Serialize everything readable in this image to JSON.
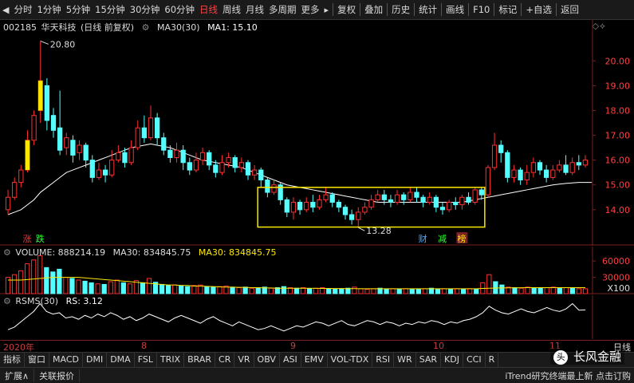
{
  "toolbar": {
    "periods": [
      "分时",
      "1分钟",
      "5分钟",
      "15分钟",
      "30分钟",
      "60分钟",
      "日线",
      "周线",
      "月线",
      "多周期",
      "更多"
    ],
    "active_period": "日线",
    "more_arrow": "▸",
    "tools": [
      "复权",
      "叠加",
      "历史",
      "统计",
      "画线",
      "F10",
      "标记",
      "+自选",
      "返回"
    ]
  },
  "main": {
    "title": {
      "code": "002185",
      "name": "华天科技",
      "mode": "(日线 前复权)",
      "ma_label": "MA30(30)",
      "ma_value": "MA1: 15.10"
    },
    "annotations": {
      "high_label": "20.80",
      "low_label": "13.28",
      "tag_zhang": "涨",
      "tag_die": "跌",
      "tag_cai": "财",
      "tag_jian": "减",
      "tag_bang": "榜"
    },
    "colors": {
      "up": "#ff3030",
      "down": "#55ffff",
      "ma": "#ffffff",
      "box": "#ffe800",
      "axis": "#7a2020",
      "label": "#ff4040"
    }
  },
  "volume": {
    "title": "VOLUME: 888214.19",
    "ma30": "MA30: 834845.75",
    "ma30b": "MA30: 834845.75",
    "scale": "X100",
    "ticks": [
      "60000",
      "30000"
    ]
  },
  "rsms": {
    "title": "RSMS(30)",
    "value": "RS: 3.12"
  },
  "date_axis": {
    "labels": [
      "2020年",
      "8",
      "9",
      "10",
      "11"
    ],
    "day": "日线"
  },
  "indicators": [
    "指标",
    "窗口",
    "MACD",
    "DMI",
    "DMA",
    "FSL",
    "TRIX",
    "BRAR",
    "CR",
    "VR",
    "OBV",
    "ASI",
    "EMV",
    "VOL-TDX",
    "RSI",
    "WR",
    "SAR",
    "KDJ",
    "CCI",
    "R"
  ],
  "status": {
    "expand": "扩展∧",
    "report": "关联报价",
    "brand": "长风金融",
    "right": "iTrend研究终端最上新 点击订购"
  },
  "chart_data": [
    {
      "type": "candlestick",
      "title": "002185 华天科技 (日线 前复权)",
      "y_ticks": [
        14.0,
        15.0,
        16.0,
        17.0,
        18.0,
        19.0,
        20.0
      ],
      "ylim": [
        12.9,
        21.2
      ],
      "x_labels": [
        "2020年",
        "8",
        "9",
        "10",
        "11"
      ],
      "high_annotation": 20.8,
      "low_annotation": 13.28,
      "ma30_last": 15.1,
      "candles": [
        {
          "o": 14.0,
          "c": 14.5,
          "h": 14.8,
          "l": 13.8
        },
        {
          "o": 14.5,
          "c": 15.1,
          "h": 15.3,
          "l": 14.4
        },
        {
          "o": 15.1,
          "c": 15.6,
          "h": 15.8,
          "l": 14.9
        },
        {
          "o": 15.6,
          "c": 16.8,
          "h": 17.2,
          "l": 15.5
        },
        {
          "o": 16.8,
          "c": 17.8,
          "h": 18.0,
          "l": 16.6
        },
        {
          "o": 18.0,
          "c": 19.2,
          "h": 20.8,
          "l": 17.5
        },
        {
          "o": 19.0,
          "c": 17.6,
          "h": 19.3,
          "l": 17.2
        },
        {
          "o": 17.8,
          "c": 17.2,
          "h": 18.1,
          "l": 16.9
        },
        {
          "o": 17.3,
          "c": 16.4,
          "h": 18.8,
          "l": 16.2
        },
        {
          "o": 16.5,
          "c": 16.9,
          "h": 17.1,
          "l": 16.2
        },
        {
          "o": 16.8,
          "c": 16.2,
          "h": 17.0,
          "l": 15.9
        },
        {
          "o": 16.3,
          "c": 16.6,
          "h": 16.8,
          "l": 16.0
        },
        {
          "o": 16.6,
          "c": 16.0,
          "h": 16.7,
          "l": 15.7
        },
        {
          "o": 16.0,
          "c": 15.3,
          "h": 16.2,
          "l": 15.1
        },
        {
          "o": 15.3,
          "c": 15.6,
          "h": 15.9,
          "l": 15.2
        },
        {
          "o": 15.6,
          "c": 15.4,
          "h": 15.8,
          "l": 15.1
        },
        {
          "o": 15.4,
          "c": 16.0,
          "h": 16.4,
          "l": 15.3
        },
        {
          "o": 16.0,
          "c": 16.3,
          "h": 16.6,
          "l": 15.9
        },
        {
          "o": 16.3,
          "c": 15.9,
          "h": 16.5,
          "l": 15.7
        },
        {
          "o": 15.9,
          "c": 16.5,
          "h": 16.8,
          "l": 15.8
        },
        {
          "o": 16.5,
          "c": 17.3,
          "h": 17.6,
          "l": 16.4
        },
        {
          "o": 17.3,
          "c": 16.9,
          "h": 17.8,
          "l": 16.7
        },
        {
          "o": 16.9,
          "c": 17.7,
          "h": 18.2,
          "l": 16.8
        },
        {
          "o": 17.7,
          "c": 16.9,
          "h": 17.9,
          "l": 16.6
        },
        {
          "o": 16.9,
          "c": 16.4,
          "h": 17.1,
          "l": 16.2
        },
        {
          "o": 16.4,
          "c": 16.1,
          "h": 16.6,
          "l": 15.9
        },
        {
          "o": 16.1,
          "c": 16.4,
          "h": 16.7,
          "l": 15.9
        },
        {
          "o": 16.4,
          "c": 15.9,
          "h": 16.6,
          "l": 15.6
        },
        {
          "o": 15.9,
          "c": 15.6,
          "h": 16.1,
          "l": 15.4
        },
        {
          "o": 15.6,
          "c": 16.0,
          "h": 16.3,
          "l": 15.5
        },
        {
          "o": 16.0,
          "c": 16.3,
          "h": 16.5,
          "l": 15.8
        },
        {
          "o": 16.3,
          "c": 15.8,
          "h": 16.4,
          "l": 15.6
        },
        {
          "o": 15.8,
          "c": 15.5,
          "h": 16.0,
          "l": 15.3
        },
        {
          "o": 15.5,
          "c": 15.9,
          "h": 16.2,
          "l": 15.4
        },
        {
          "o": 15.9,
          "c": 16.1,
          "h": 16.3,
          "l": 15.7
        },
        {
          "o": 16.1,
          "c": 15.7,
          "h": 16.2,
          "l": 15.5
        },
        {
          "o": 15.7,
          "c": 15.9,
          "h": 16.1,
          "l": 15.5
        },
        {
          "o": 15.9,
          "c": 15.4,
          "h": 16.0,
          "l": 15.2
        },
        {
          "o": 15.4,
          "c": 15.6,
          "h": 15.8,
          "l": 15.2
        },
        {
          "o": 15.6,
          "c": 15.2,
          "h": 15.7,
          "l": 14.9
        },
        {
          "o": 15.2,
          "c": 14.7,
          "h": 15.3,
          "l": 14.5
        },
        {
          "o": 14.7,
          "c": 15.0,
          "h": 15.2,
          "l": 14.6
        },
        {
          "o": 15.0,
          "c": 14.4,
          "h": 15.1,
          "l": 14.2
        },
        {
          "o": 14.4,
          "c": 13.9,
          "h": 14.5,
          "l": 13.7
        },
        {
          "o": 13.9,
          "c": 14.3,
          "h": 14.5,
          "l": 13.6
        },
        {
          "o": 14.3,
          "c": 14.0,
          "h": 14.4,
          "l": 13.8
        },
        {
          "o": 14.0,
          "c": 14.3,
          "h": 14.5,
          "l": 13.9
        },
        {
          "o": 14.3,
          "c": 14.1,
          "h": 14.6,
          "l": 13.9
        },
        {
          "o": 14.1,
          "c": 14.4,
          "h": 14.6,
          "l": 14.0
        },
        {
          "o": 14.4,
          "c": 14.6,
          "h": 14.9,
          "l": 14.3
        },
        {
          "o": 14.6,
          "c": 14.3,
          "h": 14.7,
          "l": 14.1
        },
        {
          "o": 14.3,
          "c": 14.1,
          "h": 14.4,
          "l": 13.9
        },
        {
          "o": 14.1,
          "c": 13.8,
          "h": 14.2,
          "l": 13.6
        },
        {
          "o": 13.8,
          "c": 13.6,
          "h": 14.0,
          "l": 13.4
        },
        {
          "o": 13.6,
          "c": 13.9,
          "h": 14.1,
          "l": 13.28
        },
        {
          "o": 13.9,
          "c": 14.1,
          "h": 14.3,
          "l": 13.8
        },
        {
          "o": 14.1,
          "c": 14.4,
          "h": 14.6,
          "l": 14.0
        },
        {
          "o": 14.4,
          "c": 14.6,
          "h": 14.8,
          "l": 14.3
        },
        {
          "o": 14.6,
          "c": 14.4,
          "h": 14.8,
          "l": 14.2
        },
        {
          "o": 14.4,
          "c": 14.3,
          "h": 14.6,
          "l": 14.1
        },
        {
          "o": 14.3,
          "c": 14.6,
          "h": 14.8,
          "l": 14.2
        },
        {
          "o": 14.6,
          "c": 14.4,
          "h": 14.7,
          "l": 14.2
        },
        {
          "o": 14.4,
          "c": 14.7,
          "h": 14.9,
          "l": 14.3
        },
        {
          "o": 14.7,
          "c": 14.5,
          "h": 14.9,
          "l": 14.3
        },
        {
          "o": 14.5,
          "c": 14.3,
          "h": 14.6,
          "l": 14.1
        },
        {
          "o": 14.3,
          "c": 14.5,
          "h": 14.7,
          "l": 14.2
        },
        {
          "o": 14.5,
          "c": 14.1,
          "h": 14.6,
          "l": 13.9
        },
        {
          "o": 14.1,
          "c": 14.0,
          "h": 14.3,
          "l": 13.8
        },
        {
          "o": 14.0,
          "c": 14.3,
          "h": 14.4,
          "l": 13.9
        },
        {
          "o": 14.3,
          "c": 14.2,
          "h": 14.5,
          "l": 14.0
        },
        {
          "o": 14.2,
          "c": 14.5,
          "h": 14.6,
          "l": 14.0
        },
        {
          "o": 14.5,
          "c": 14.3,
          "h": 14.7,
          "l": 14.2
        },
        {
          "o": 14.3,
          "c": 14.8,
          "h": 14.9,
          "l": 14.2
        },
        {
          "o": 14.8,
          "c": 14.6,
          "h": 14.9,
          "l": 14.4
        },
        {
          "o": 14.6,
          "c": 15.7,
          "h": 15.8,
          "l": 14.5
        },
        {
          "o": 15.7,
          "c": 16.6,
          "h": 17.1,
          "l": 15.6
        },
        {
          "o": 16.6,
          "c": 16.3,
          "h": 16.8,
          "l": 15.9
        },
        {
          "o": 16.3,
          "c": 15.3,
          "h": 16.4,
          "l": 15.1
        },
        {
          "o": 15.3,
          "c": 15.6,
          "h": 15.8,
          "l": 15.1
        },
        {
          "o": 15.6,
          "c": 15.2,
          "h": 15.7,
          "l": 15.0
        },
        {
          "o": 15.2,
          "c": 15.5,
          "h": 15.8,
          "l": 15.0
        },
        {
          "o": 15.5,
          "c": 15.9,
          "h": 16.1,
          "l": 15.3
        },
        {
          "o": 15.9,
          "c": 15.6,
          "h": 16.0,
          "l": 15.4
        },
        {
          "o": 15.6,
          "c": 15.3,
          "h": 15.8,
          "l": 15.1
        },
        {
          "o": 15.3,
          "c": 15.6,
          "h": 15.8,
          "l": 15.2
        },
        {
          "o": 15.6,
          "c": 15.8,
          "h": 16.0,
          "l": 15.5
        },
        {
          "o": 15.8,
          "c": 15.5,
          "h": 16.2,
          "l": 15.4
        },
        {
          "o": 15.5,
          "c": 15.9,
          "h": 16.1,
          "l": 15.4
        },
        {
          "o": 15.9,
          "c": 15.8,
          "h": 16.2,
          "l": 15.6
        },
        {
          "o": 15.8,
          "c": 16.0,
          "h": 16.2,
          "l": 15.7
        }
      ],
      "ma30": [
        13.8,
        13.9,
        14.0,
        14.2,
        14.4,
        14.7,
        14.9,
        15.1,
        15.3,
        15.5,
        15.6,
        15.7,
        15.8,
        15.9,
        16.0,
        16.1,
        16.2,
        16.3,
        16.4,
        16.5,
        16.55,
        16.6,
        16.65,
        16.6,
        16.55,
        16.5,
        16.4,
        16.3,
        16.2,
        16.1,
        16.0,
        15.95,
        15.9,
        15.85,
        15.8,
        15.75,
        15.7,
        15.6,
        15.5,
        15.4,
        15.3,
        15.2,
        15.1,
        15.0,
        14.95,
        14.9,
        14.85,
        14.8,
        14.75,
        14.7,
        14.65,
        14.6,
        14.55,
        14.5,
        14.45,
        14.4,
        14.35,
        14.3,
        14.3,
        14.3,
        14.3,
        14.3,
        14.3,
        14.3,
        14.3,
        14.3,
        14.3,
        14.3,
        14.3,
        14.3,
        14.3,
        14.35,
        14.4,
        14.45,
        14.5,
        14.55,
        14.6,
        14.65,
        14.7,
        14.75,
        14.8,
        14.85,
        14.9,
        14.95,
        15.0,
        15.03,
        15.06,
        15.08,
        15.1,
        15.1,
        15.1
      ],
      "highlight_box": {
        "x_from_index": 39,
        "x_to_index": 73,
        "y_from": 13.3,
        "y_to": 14.9
      }
    },
    {
      "type": "bar",
      "title": "VOLUME",
      "y_ticks": [
        30000,
        60000
      ],
      "ylim": [
        0,
        75000
      ],
      "scale_note": "X100",
      "values": [
        30000,
        35000,
        42000,
        55000,
        62000,
        70000,
        48000,
        40000,
        45000,
        30000,
        28000,
        25000,
        23000,
        20000,
        18000,
        17000,
        22000,
        25000,
        20000,
        18000,
        24000,
        20000,
        28000,
        21000,
        17000,
        15000,
        16000,
        14000,
        13000,
        15000,
        16000,
        13000,
        12000,
        13000,
        14000,
        12000,
        11000,
        12000,
        10000,
        11000,
        12000,
        10000,
        11000,
        13000,
        11000,
        10000,
        11000,
        9000,
        10000,
        11000,
        9000,
        8000,
        9000,
        10000,
        12000,
        9000,
        8000,
        9000,
        10000,
        8000,
        9000,
        8000,
        9000,
        8000,
        8000,
        9000,
        10000,
        8000,
        9000,
        8000,
        9000,
        8000,
        9000,
        8000,
        20000,
        35000,
        22000,
        16000,
        12000,
        11000,
        10000,
        12000,
        11000,
        10000,
        11000,
        12000,
        10000,
        11000,
        10000,
        9000,
        9000
      ],
      "ma30": [
        25000,
        25000,
        25000,
        26000,
        27000,
        28000,
        29000,
        30000,
        30000,
        30000,
        30000,
        30000,
        29000,
        28000,
        27000,
        26000,
        25000,
        24000,
        23000,
        22000,
        21000,
        20000,
        19000,
        18000,
        17000,
        16000,
        16000,
        15000,
        15000,
        14000,
        14000,
        13500,
        13000,
        12500,
        12000,
        12000,
        11500,
        11500,
        11000,
        11000,
        10500,
        10500,
        10000,
        10000,
        10000,
        10000,
        10000,
        10000,
        9800,
        9600,
        9500,
        9400,
        9300,
        9200,
        9100,
        9000,
        9000,
        9000,
        9000,
        9000,
        9000,
        9000,
        9000,
        9000,
        9000,
        9000,
        9000,
        9000,
        9000,
        9000,
        9000,
        9000,
        9000,
        9000,
        9500,
        10000,
        10300,
        10500,
        10700,
        10800,
        10900,
        11000,
        11000,
        11000,
        11000,
        11000,
        11000,
        11000,
        11000,
        11000,
        11000
      ]
    },
    {
      "type": "line",
      "title": "RSMS(30)",
      "last_value": 3.12,
      "values": [
        1.6,
        1.8,
        2.2,
        2.6,
        3.0,
        3.6,
        3.0,
        2.8,
        2.9,
        2.5,
        2.6,
        2.4,
        2.7,
        2.5,
        2.8,
        2.6,
        2.9,
        2.7,
        2.4,
        2.6,
        2.3,
        2.5,
        2.8,
        2.6,
        2.4,
        2.2,
        2.5,
        2.7,
        2.5,
        2.3,
        2.1,
        2.4,
        2.6,
        2.3,
        2.1,
        1.9,
        2.2,
        2.0,
        1.8,
        1.6,
        1.7,
        1.9,
        1.7,
        1.5,
        1.7,
        1.9,
        1.8,
        2.0,
        2.2,
        2.1,
        1.9,
        2.1,
        2.3,
        2.0,
        1.9,
        2.1,
        2.3,
        2.2,
        2.0,
        2.2,
        2.1,
        1.9,
        2.1,
        2.0,
        2.2,
        2.1,
        2.3,
        2.2,
        2.0,
        2.2,
        2.1,
        2.3,
        2.4,
        2.6,
        2.9,
        3.4,
        3.1,
        2.9,
        2.8,
        3.0,
        3.2,
        3.0,
        2.9,
        3.1,
        3.3,
        3.1,
        3.0,
        3.2,
        3.6,
        3.1,
        3.12
      ],
      "ylim": [
        1.0,
        4.0
      ]
    }
  ]
}
